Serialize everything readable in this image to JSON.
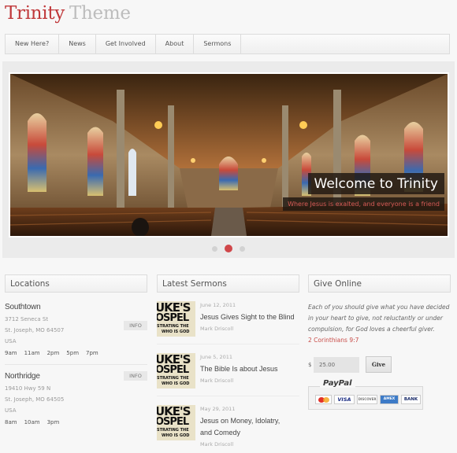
{
  "site": {
    "title_part1": "Trinity",
    "title_part2": "Theme"
  },
  "nav": {
    "items": [
      "New Here?",
      "News",
      "Get Involved",
      "About",
      "Sermons"
    ]
  },
  "slider": {
    "image": "church-interior-panorama",
    "caption_title": "Welcome to Trinity",
    "caption_subtitle": "Where Jesus is exalted, and everyone is a friend",
    "slide_count": 3,
    "active_slide": 2
  },
  "locations": {
    "heading": "Locations",
    "info_label": "INFO",
    "items": [
      {
        "name": "Southtown",
        "street": "3712 Seneca St",
        "city": "St. Joseph, MO 64507",
        "country": "USA",
        "times": [
          "9am",
          "11am",
          "2pm",
          "5pm",
          "7pm"
        ]
      },
      {
        "name": "Northridge",
        "street": "19410 Hwy 59 N",
        "city": "St. Joseph, MO 64505",
        "country": "USA",
        "times": [
          "8am",
          "10am",
          "3pm"
        ]
      }
    ]
  },
  "sermons": {
    "heading": "Latest Sermons",
    "thumb_text": [
      "UKE'S",
      "OSPEL",
      "STRATING THE",
      "WHO IS GOD"
    ],
    "items": [
      {
        "date": "June 12, 2011",
        "title": "Jesus Gives Sight to the Blind",
        "author": "Mark Driscoll"
      },
      {
        "date": "June 5, 2011",
        "title": "The Bible Is about Jesus",
        "author": "Mark Driscoll"
      },
      {
        "date": "May 29, 2011",
        "title": "Jesus on Money, Idolatry, and Comedy",
        "author": "Mark Driscoll"
      }
    ]
  },
  "give": {
    "heading": "Give Online",
    "quote": "Each of you should give what you have decided in your heart to give, not reluctantly or under compulsion, for God loves a cheerful giver.",
    "reference": "2 Corinthians 9:7",
    "currency": "$",
    "amount": "25.00",
    "button_label": "Give",
    "paypal_label": "PayPal",
    "cards": [
      "MasterCard",
      "VISA",
      "DISCOVER",
      "AMEX",
      "BANK"
    ]
  },
  "colors": {
    "accent": "#c0393b",
    "muted_title": "#bdbdbd",
    "dot_active": "#d0474a",
    "dot_inactive": "#d2d2d2"
  }
}
